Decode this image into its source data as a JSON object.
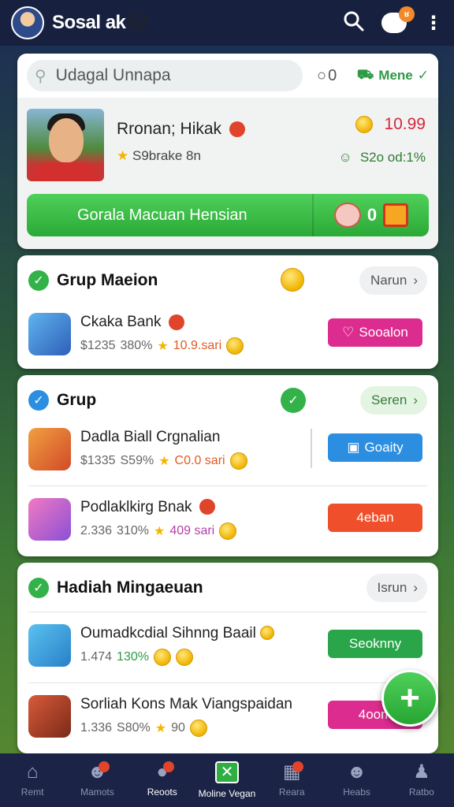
{
  "app": {
    "title": "Sosal ak",
    "title_emoji": "🐱",
    "notification_badge": "ʁ"
  },
  "profile_card": {
    "search_text": "Udagal Unnapa",
    "toggle_text": "○0",
    "menu_label": "Mene",
    "name": "Rronan; Hikak",
    "subtitle": "S9brake 8n",
    "coin_value": "10.99",
    "stat_value": "S2o od:1%",
    "cta_label": "Gorala Macuan Hensian",
    "cta_count": "0"
  },
  "section1": {
    "title": "Grup Maeion",
    "pill_label": "Narun",
    "items": [
      {
        "name": "Ckaka Bank",
        "price": "$1235",
        "percent": "380%",
        "stars": "10.9.sari",
        "action": "Sooalon",
        "action_color": "#dd2c8f"
      }
    ]
  },
  "section2": {
    "title": "Grup",
    "pill_label": "Seren",
    "items": [
      {
        "name": "Dadla Biall Crgnalian",
        "price": "$1335",
        "percent": "S59%",
        "stars": "C0.0 sari",
        "action": "Goaity",
        "action_color": "#2b8ee0"
      },
      {
        "name": "Podlaklkirg Bnak",
        "price": "2.336",
        "percent": "310%",
        "stars": "409 sari",
        "action": "4eban",
        "action_color": "#ef4f2a"
      }
    ]
  },
  "section3": {
    "title": "Hadiah Mingaeuan",
    "pill_label": "Isrun",
    "items": [
      {
        "name": "Oumadkcdial Sihnng Baail",
        "price": "1.474",
        "percent": "130%",
        "stars": "",
        "action": "Seoknny",
        "action_color": "#2aa54a"
      },
      {
        "name": "Sorliah Kons Mak Viangspaidan",
        "price": "1.336",
        "percent": "S80%",
        "stars": "90",
        "action": "4oom",
        "action_color": "#dd2c8f"
      }
    ]
  },
  "bottom_nav": [
    {
      "label": "Remt",
      "icon": "home-icon"
    },
    {
      "label": "Mamots",
      "icon": "games-icon"
    },
    {
      "label": "Reoots",
      "icon": "chat-icon"
    },
    {
      "label": "Moline Vegan",
      "icon": "x-icon"
    },
    {
      "label": "Reara",
      "icon": "store-icon"
    },
    {
      "label": "Heabs",
      "icon": "heart-icon"
    },
    {
      "label": "Ratbo",
      "icon": "profile-icon"
    }
  ]
}
